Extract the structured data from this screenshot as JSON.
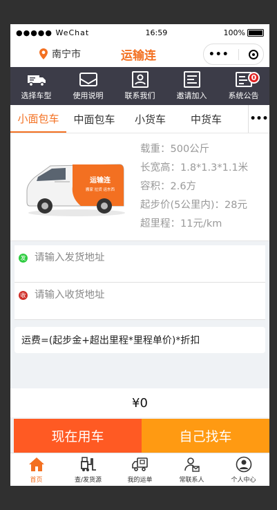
{
  "status_bar": {
    "signal": "●●●●● WeChat",
    "time": "16:59",
    "battery": "100%"
  },
  "navbar": {
    "location": "南宁市",
    "title": "运输连"
  },
  "toolbar": [
    {
      "label": "选择车型",
      "icon": "truck-icon"
    },
    {
      "label": "使用说明",
      "icon": "envelope-icon"
    },
    {
      "label": "联系我们",
      "icon": "contact-card-icon"
    },
    {
      "label": "邀请加入",
      "icon": "invite-icon"
    },
    {
      "label": "系统公告",
      "icon": "announcement-icon",
      "badge": "0"
    }
  ],
  "vehicle_tabs": {
    "items": [
      "小面包车",
      "中面包车",
      "小货车",
      "中货车"
    ],
    "active": "小面包车",
    "more": "•••"
  },
  "vehicle": {
    "image_text": {
      "brand": "运输连",
      "slogan": "搬家 拉货 运东西"
    },
    "specs": [
      "载重：500公斤",
      "长宽高：1.8*1.3*1.1米",
      "容积：2.6方",
      "起步价(5公里内)：28元",
      "超里程：11元/km"
    ]
  },
  "pickup": {
    "badge": "发",
    "placeholder": "请输入发货地址"
  },
  "delivery": {
    "badge": "收",
    "placeholder": "请输入收货地址"
  },
  "formula": "运费=(起步金+超出里程*里程单价)*折扣",
  "price": "¥0",
  "actions": {
    "primary": "现在用车",
    "secondary": "自己找车"
  },
  "tabbar": [
    {
      "label": "首页",
      "icon": "home-icon",
      "active": true
    },
    {
      "label": "查/发货源",
      "icon": "forklift-icon"
    },
    {
      "label": "我的运单",
      "icon": "delivery-truck-icon"
    },
    {
      "label": "常联系人",
      "icon": "contact-person-icon"
    },
    {
      "label": "个人中心",
      "icon": "user-icon"
    }
  ],
  "colors": {
    "accent": "#f37021",
    "toolbar_bg": "#3c3c48",
    "primary_button": "#ff5a23",
    "secondary_button": "#ff9a12",
    "pickup_badge": "#2ecc40",
    "delivery_badge": "#d0302a"
  }
}
